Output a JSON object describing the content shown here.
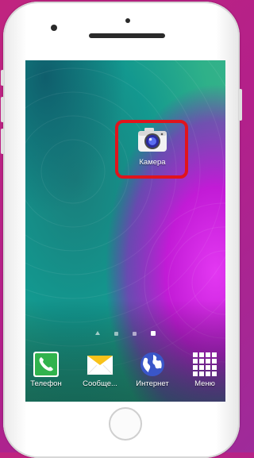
{
  "home_screen": {
    "camera_app": {
      "label": "Камера",
      "icon": "camera-icon"
    },
    "page_indicator": {
      "pages": 4,
      "active_index": 3
    }
  },
  "dock": [
    {
      "label": "Телефон",
      "icon": "phone-icon"
    },
    {
      "label": "Сообще...",
      "icon": "messages-icon"
    },
    {
      "label": "Интернет",
      "icon": "globe-icon"
    },
    {
      "label": "Меню",
      "icon": "apps-grid-icon"
    }
  ],
  "colors": {
    "background": "#c0247f",
    "highlight": "#e0141c",
    "wallpaper_teal": "#168a86",
    "wallpaper_magenta": "#c21bd6"
  }
}
